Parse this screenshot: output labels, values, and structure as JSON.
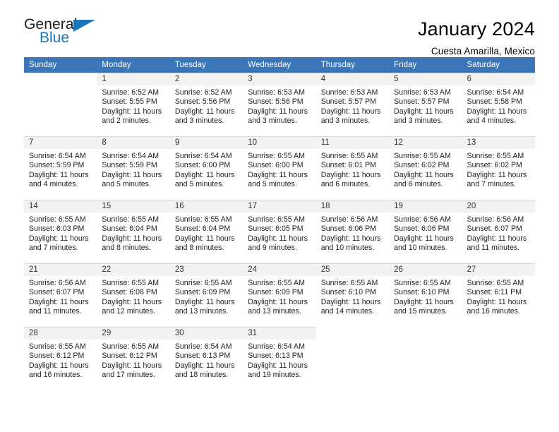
{
  "brand": {
    "name_part1": "General",
    "name_part2": "Blue",
    "flag_icon": "triangle-flag-icon",
    "accent_color": "#1b75bb"
  },
  "header": {
    "title": "January 2024",
    "subtitle": "Cuesta Amarilla, Mexico"
  },
  "calendar": {
    "header_bg": "#3b77b8",
    "daynum_bg": "#f2f2f2",
    "weekdays": [
      "Sunday",
      "Monday",
      "Tuesday",
      "Wednesday",
      "Thursday",
      "Friday",
      "Saturday"
    ],
    "weeks": [
      [
        {
          "day": "",
          "blank": true
        },
        {
          "day": "1",
          "sunrise": "Sunrise: 6:52 AM",
          "sunset": "Sunset: 5:55 PM",
          "daylight1": "Daylight: 11 hours",
          "daylight2": "and 2 minutes."
        },
        {
          "day": "2",
          "sunrise": "Sunrise: 6:52 AM",
          "sunset": "Sunset: 5:56 PM",
          "daylight1": "Daylight: 11 hours",
          "daylight2": "and 3 minutes."
        },
        {
          "day": "3",
          "sunrise": "Sunrise: 6:53 AM",
          "sunset": "Sunset: 5:56 PM",
          "daylight1": "Daylight: 11 hours",
          "daylight2": "and 3 minutes."
        },
        {
          "day": "4",
          "sunrise": "Sunrise: 6:53 AM",
          "sunset": "Sunset: 5:57 PM",
          "daylight1": "Daylight: 11 hours",
          "daylight2": "and 3 minutes."
        },
        {
          "day": "5",
          "sunrise": "Sunrise: 6:53 AM",
          "sunset": "Sunset: 5:57 PM",
          "daylight1": "Daylight: 11 hours",
          "daylight2": "and 3 minutes."
        },
        {
          "day": "6",
          "sunrise": "Sunrise: 6:54 AM",
          "sunset": "Sunset: 5:58 PM",
          "daylight1": "Daylight: 11 hours",
          "daylight2": "and 4 minutes."
        }
      ],
      [
        {
          "day": "7",
          "sunrise": "Sunrise: 6:54 AM",
          "sunset": "Sunset: 5:59 PM",
          "daylight1": "Daylight: 11 hours",
          "daylight2": "and 4 minutes."
        },
        {
          "day": "8",
          "sunrise": "Sunrise: 6:54 AM",
          "sunset": "Sunset: 5:59 PM",
          "daylight1": "Daylight: 11 hours",
          "daylight2": "and 5 minutes."
        },
        {
          "day": "9",
          "sunrise": "Sunrise: 6:54 AM",
          "sunset": "Sunset: 6:00 PM",
          "daylight1": "Daylight: 11 hours",
          "daylight2": "and 5 minutes."
        },
        {
          "day": "10",
          "sunrise": "Sunrise: 6:55 AM",
          "sunset": "Sunset: 6:00 PM",
          "daylight1": "Daylight: 11 hours",
          "daylight2": "and 5 minutes."
        },
        {
          "day": "11",
          "sunrise": "Sunrise: 6:55 AM",
          "sunset": "Sunset: 6:01 PM",
          "daylight1": "Daylight: 11 hours",
          "daylight2": "and 6 minutes."
        },
        {
          "day": "12",
          "sunrise": "Sunrise: 6:55 AM",
          "sunset": "Sunset: 6:02 PM",
          "daylight1": "Daylight: 11 hours",
          "daylight2": "and 6 minutes."
        },
        {
          "day": "13",
          "sunrise": "Sunrise: 6:55 AM",
          "sunset": "Sunset: 6:02 PM",
          "daylight1": "Daylight: 11 hours",
          "daylight2": "and 7 minutes."
        }
      ],
      [
        {
          "day": "14",
          "sunrise": "Sunrise: 6:55 AM",
          "sunset": "Sunset: 6:03 PM",
          "daylight1": "Daylight: 11 hours",
          "daylight2": "and 7 minutes."
        },
        {
          "day": "15",
          "sunrise": "Sunrise: 6:55 AM",
          "sunset": "Sunset: 6:04 PM",
          "daylight1": "Daylight: 11 hours",
          "daylight2": "and 8 minutes."
        },
        {
          "day": "16",
          "sunrise": "Sunrise: 6:55 AM",
          "sunset": "Sunset: 6:04 PM",
          "daylight1": "Daylight: 11 hours",
          "daylight2": "and 8 minutes."
        },
        {
          "day": "17",
          "sunrise": "Sunrise: 6:55 AM",
          "sunset": "Sunset: 6:05 PM",
          "daylight1": "Daylight: 11 hours",
          "daylight2": "and 9 minutes."
        },
        {
          "day": "18",
          "sunrise": "Sunrise: 6:56 AM",
          "sunset": "Sunset: 6:06 PM",
          "daylight1": "Daylight: 11 hours",
          "daylight2": "and 10 minutes."
        },
        {
          "day": "19",
          "sunrise": "Sunrise: 6:56 AM",
          "sunset": "Sunset: 6:06 PM",
          "daylight1": "Daylight: 11 hours",
          "daylight2": "and 10 minutes."
        },
        {
          "day": "20",
          "sunrise": "Sunrise: 6:56 AM",
          "sunset": "Sunset: 6:07 PM",
          "daylight1": "Daylight: 11 hours",
          "daylight2": "and 11 minutes."
        }
      ],
      [
        {
          "day": "21",
          "sunrise": "Sunrise: 6:56 AM",
          "sunset": "Sunset: 6:07 PM",
          "daylight1": "Daylight: 11 hours",
          "daylight2": "and 11 minutes."
        },
        {
          "day": "22",
          "sunrise": "Sunrise: 6:55 AM",
          "sunset": "Sunset: 6:08 PM",
          "daylight1": "Daylight: 11 hours",
          "daylight2": "and 12 minutes."
        },
        {
          "day": "23",
          "sunrise": "Sunrise: 6:55 AM",
          "sunset": "Sunset: 6:09 PM",
          "daylight1": "Daylight: 11 hours",
          "daylight2": "and 13 minutes."
        },
        {
          "day": "24",
          "sunrise": "Sunrise: 6:55 AM",
          "sunset": "Sunset: 6:09 PM",
          "daylight1": "Daylight: 11 hours",
          "daylight2": "and 13 minutes."
        },
        {
          "day": "25",
          "sunrise": "Sunrise: 6:55 AM",
          "sunset": "Sunset: 6:10 PM",
          "daylight1": "Daylight: 11 hours",
          "daylight2": "and 14 minutes."
        },
        {
          "day": "26",
          "sunrise": "Sunrise: 6:55 AM",
          "sunset": "Sunset: 6:10 PM",
          "daylight1": "Daylight: 11 hours",
          "daylight2": "and 15 minutes."
        },
        {
          "day": "27",
          "sunrise": "Sunrise: 6:55 AM",
          "sunset": "Sunset: 6:11 PM",
          "daylight1": "Daylight: 11 hours",
          "daylight2": "and 16 minutes."
        }
      ],
      [
        {
          "day": "28",
          "sunrise": "Sunrise: 6:55 AM",
          "sunset": "Sunset: 6:12 PM",
          "daylight1": "Daylight: 11 hours",
          "daylight2": "and 16 minutes."
        },
        {
          "day": "29",
          "sunrise": "Sunrise: 6:55 AM",
          "sunset": "Sunset: 6:12 PM",
          "daylight1": "Daylight: 11 hours",
          "daylight2": "and 17 minutes."
        },
        {
          "day": "30",
          "sunrise": "Sunrise: 6:54 AM",
          "sunset": "Sunset: 6:13 PM",
          "daylight1": "Daylight: 11 hours",
          "daylight2": "and 18 minutes."
        },
        {
          "day": "31",
          "sunrise": "Sunrise: 6:54 AM",
          "sunset": "Sunset: 6:13 PM",
          "daylight1": "Daylight: 11 hours",
          "daylight2": "and 19 minutes."
        },
        {
          "day": "",
          "blank": true
        },
        {
          "day": "",
          "blank": true
        },
        {
          "day": "",
          "blank": true
        }
      ]
    ]
  }
}
